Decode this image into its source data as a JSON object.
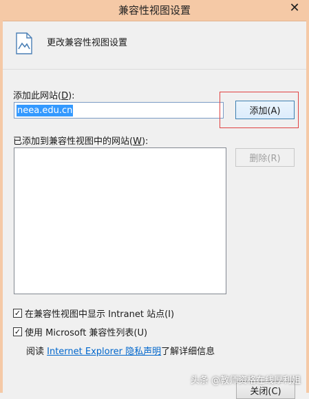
{
  "window": {
    "title": "兼容性视图设置",
    "close_glyph": "✕"
  },
  "header": {
    "text": "更改兼容性视图设置",
    "icon": "document-page-icon"
  },
  "add_site": {
    "label_prefix": "添加此网站(",
    "label_key": "D",
    "label_suffix": "):",
    "input_value": "neea.edu.cn",
    "button_label": "添加(A)"
  },
  "site_list": {
    "label_prefix": "已添加到兼容性视图中的网站(",
    "label_key": "W",
    "label_suffix": "):",
    "items": [],
    "remove_label": "删除(R)"
  },
  "options": {
    "intranet_label": "在兼容性视图中显示 Intranet 站点(I)",
    "intranet_checked": true,
    "ms_list_label": "使用 Microsoft 兼容性列表(U)",
    "ms_list_checked": true,
    "check_glyph": "✓"
  },
  "privacy": {
    "prefix": "阅读 ",
    "link": "Internet Explorer 隐私声明",
    "suffix": "了解详细信息"
  },
  "footer": {
    "close_label": "关闭(C)",
    "watermark": "头条 @教师资格在线厚利姐"
  },
  "colors": {
    "titlebar": "#f5c9a6",
    "highlight": "#e04040",
    "link": "#0066cc"
  }
}
